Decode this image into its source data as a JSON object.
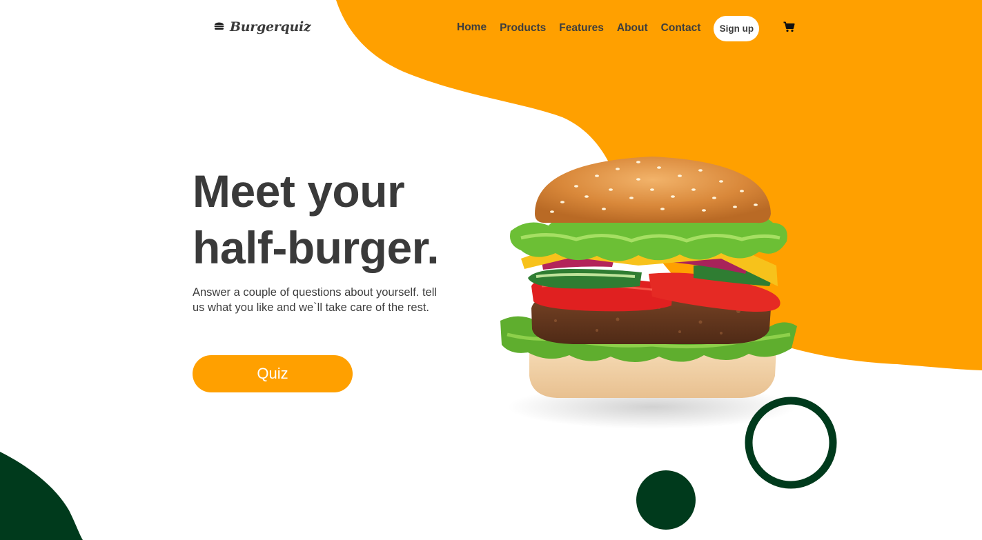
{
  "logo": {
    "text": "Burgerquiz",
    "icon": "burger-icon"
  },
  "nav": {
    "items": [
      {
        "label": "Home",
        "active": true
      },
      {
        "label": "Products",
        "active": false
      },
      {
        "label": "Features",
        "active": false
      },
      {
        "label": "About",
        "active": false
      },
      {
        "label": "Contact",
        "active": false
      }
    ],
    "signup_label": "Sign up",
    "cart_icon": "cart-icon"
  },
  "hero": {
    "headline_line1": "Meet your",
    "headline_line2": "half-burger.",
    "subtext": "Answer a couple of questions about yourself. tell us what you like and we`ll take care of the rest.",
    "cta_label": "Quiz",
    "image": "burger-image"
  },
  "colors": {
    "accent": "#ffa000",
    "dark_green": "#003a1c",
    "text": "#3d3d3d"
  }
}
